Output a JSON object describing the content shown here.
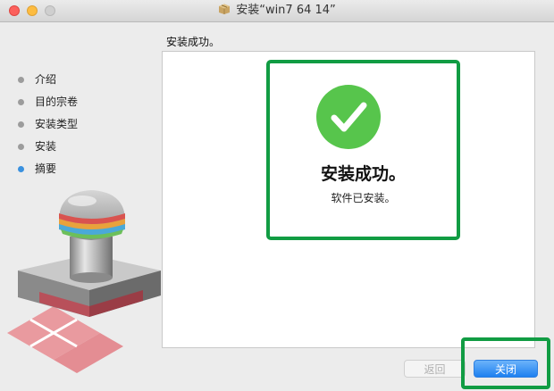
{
  "window": {
    "title": "安装“win7 64 14”"
  },
  "page": {
    "heading": "安装成功。"
  },
  "steps": [
    {
      "label": "介绍",
      "state": "done"
    },
    {
      "label": "目的宗卷",
      "state": "done"
    },
    {
      "label": "安装类型",
      "state": "done"
    },
    {
      "label": "安装",
      "state": "done"
    },
    {
      "label": "摘要",
      "state": "current"
    }
  ],
  "result": {
    "title": "安装成功。",
    "subtitle": "软件已安装。",
    "icon": "checkmark-icon"
  },
  "buttons": {
    "back": "返回",
    "close": "关闭"
  },
  "colors": {
    "accent": "#3a91df",
    "success": "#57c54c",
    "annotation": "#119c43",
    "primary_button": "#1e80f0"
  }
}
